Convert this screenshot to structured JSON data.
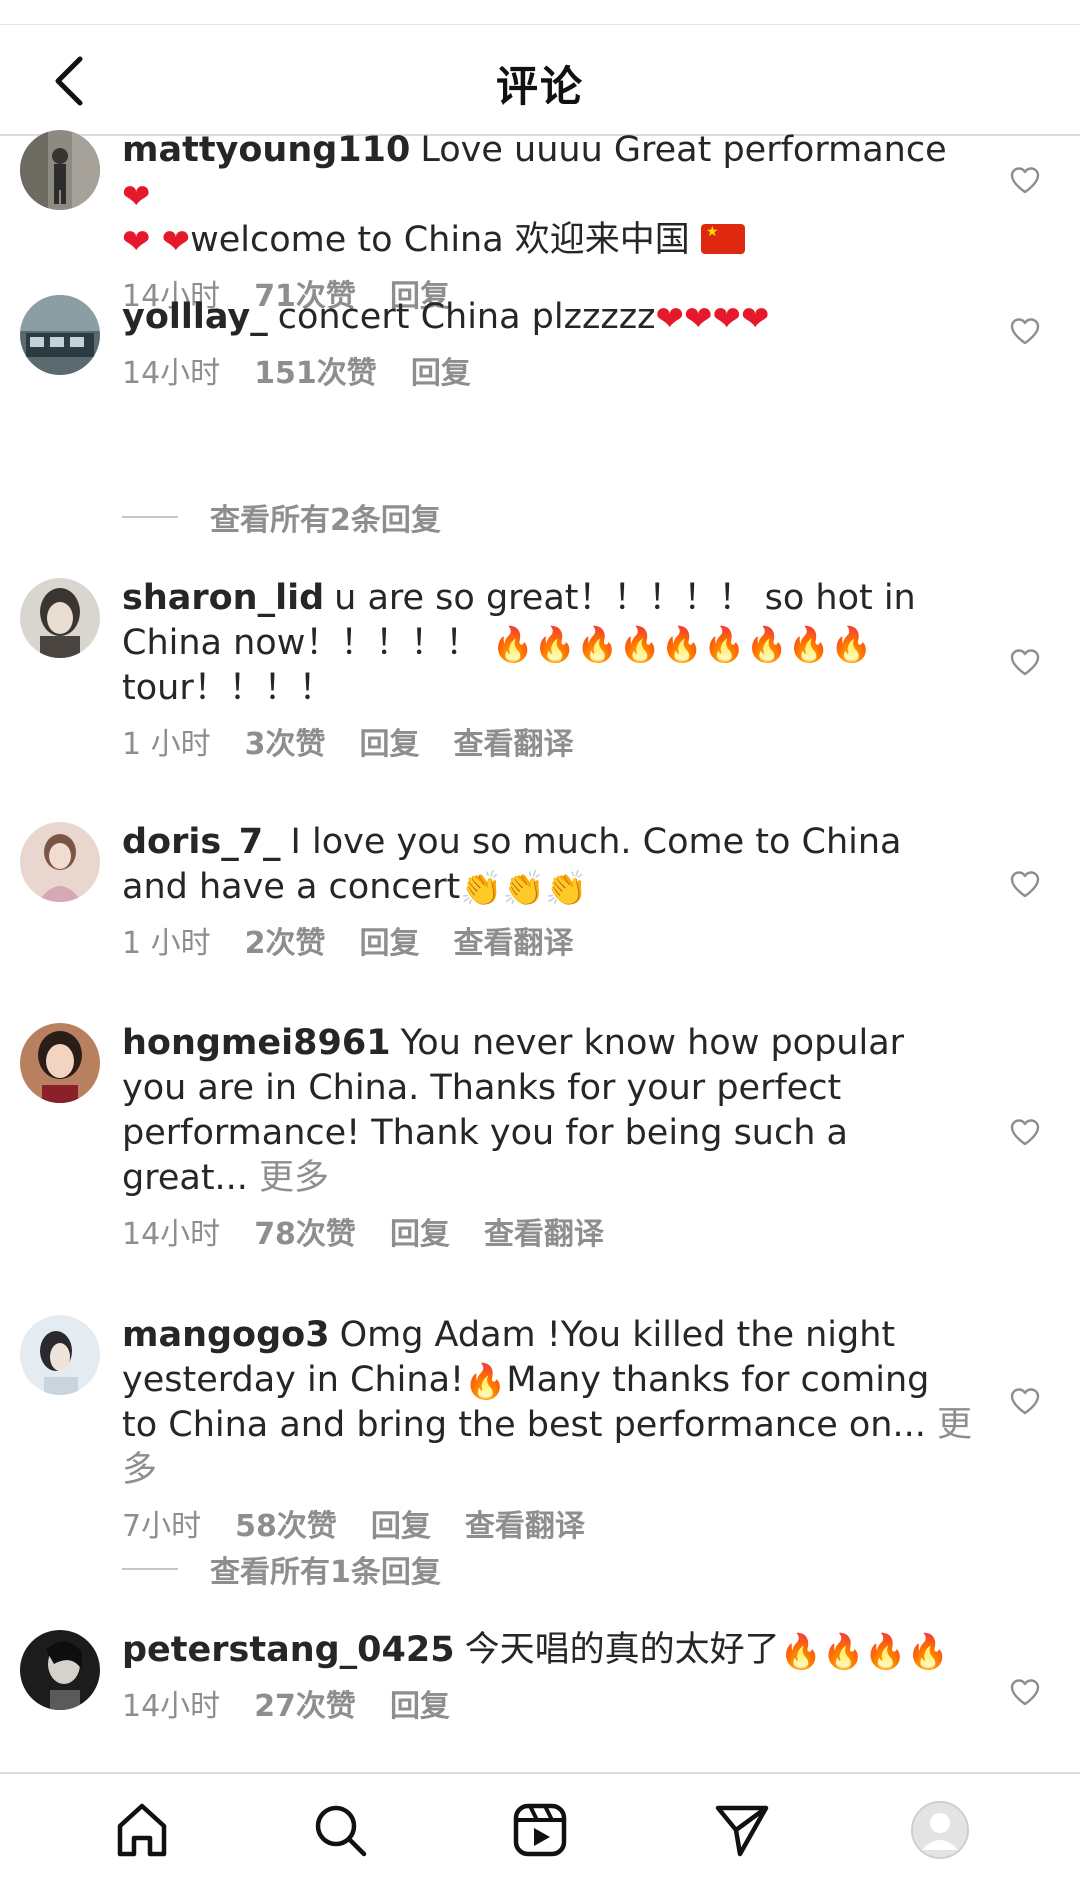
{
  "header": {
    "title": "评论"
  },
  "comments": [
    {
      "username": "mattyoung110",
      "text_parts": [
        "Love uuuu Great performance ",
        "❤",
        " ",
        "❤",
        " ",
        "❤",
        "welcome to China 欢迎来中国 "
      ],
      "time": "14小时",
      "likes": "71次赞",
      "reply": "回复",
      "translate": ""
    },
    {
      "username": "yolllay_",
      "text_parts": [
        "concert China plzzzzz",
        "❤❤❤❤"
      ],
      "time": "14小时",
      "likes": "151次赞",
      "reply": "回复",
      "translate": ""
    },
    {
      "username": "sharon_lid",
      "text_parts": [
        "u are so great！！！！！ so hot in China now！！！！！",
        "🔥🔥🔥🔥🔥🔥🔥🔥🔥",
        "tour！！！！"
      ],
      "time": "1 小时",
      "likes": "3次赞",
      "reply": "回复",
      "translate": "查看翻译"
    },
    {
      "username": "doris_7_",
      "text_parts": [
        "I love you so much. Come to China and have a concert",
        "👏👏👏"
      ],
      "time": "1 小时",
      "likes": "2次赞",
      "reply": "回复",
      "translate": "查看翻译"
    },
    {
      "username": "hongmei8961",
      "text_parts": [
        "You never know how popular you are in China. Thanks for your perfect performance! Thank you for being such a great... ",
        "更多"
      ],
      "time": "14小时",
      "likes": "78次赞",
      "reply": "回复",
      "translate": "查看翻译"
    },
    {
      "username": "mangogo3",
      "text_parts": [
        "Omg Adam !You killed the night yesterday in China!",
        "🔥",
        "Many thanks for coming to China and bring the best performance on... ",
        "更多"
      ],
      "time": "7小时",
      "likes": "58次赞",
      "reply": "回复",
      "translate": "查看翻译"
    },
    {
      "username": "peterstang_0425",
      "text_parts": [
        "今天唱的真的太好了",
        "🔥🔥🔥🔥"
      ],
      "time": "14小时",
      "likes": "27次赞",
      "reply": "回复",
      "translate": ""
    }
  ],
  "view_replies": [
    "查看所有2条回复",
    "查看所有1条回复"
  ],
  "icons": {
    "back": "chevron-left-icon",
    "like": "heart-outline-icon",
    "home": "home-icon",
    "search": "search-icon",
    "reels": "reels-icon",
    "direct": "send-icon",
    "profile": "profile-avatar-icon"
  },
  "colors": {
    "text": "#262626",
    "secondary": "#8e8e8e",
    "divider": "#dbdbdb",
    "heart_emoji": "#e5192b",
    "fire_emoji": "#ff6a00"
  }
}
